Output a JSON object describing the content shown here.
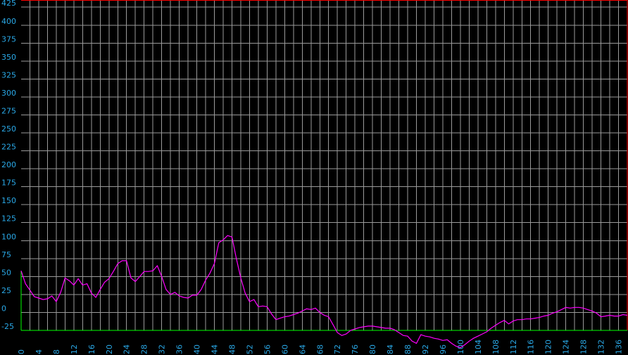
{
  "colors": {
    "background": "#000000",
    "grid": "#9a9a9a",
    "tick_label": "#2aa8e6",
    "series": "#ff00ff",
    "top_border": "#ff0000",
    "baseline": "#00ff00"
  },
  "chart_data": {
    "type": "line",
    "xlim": [
      0,
      138
    ],
    "ylim": [
      -25,
      435
    ],
    "grid": true,
    "legend": "none",
    "x_ticks": [
      0,
      4,
      8,
      12,
      16,
      20,
      24,
      28,
      32,
      36,
      40,
      44,
      48,
      52,
      56,
      60,
      64,
      68,
      72,
      76,
      80,
      84,
      88,
      92,
      96,
      100,
      104,
      108,
      112,
      116,
      120,
      124,
      128,
      132,
      136
    ],
    "x_tick_labels": [
      "0",
      "4",
      "8",
      "12",
      "16",
      "20",
      "24",
      "28",
      "32",
      "36",
      "40",
      "44",
      "48",
      "52",
      "56",
      "60",
      "64",
      "68",
      "72",
      "76",
      "80",
      "84",
      "88",
      "92",
      "96",
      "100",
      "104",
      "108",
      "112",
      "116",
      "120",
      "124",
      "128",
      "132",
      "136"
    ],
    "y_ticks": [
      -25,
      0,
      25,
      50,
      75,
      100,
      125,
      150,
      175,
      200,
      225,
      250,
      275,
      300,
      325,
      350,
      375,
      400,
      425
    ],
    "y_tick_labels": [
      "-25",
      "0",
      "25",
      "50",
      "75",
      "100",
      "125",
      "150",
      "175",
      "200",
      "225",
      "250",
      "275",
      "300",
      "325",
      "350",
      "375",
      "400",
      "425"
    ],
    "series": [
      {
        "x": [
          0,
          1,
          2,
          3,
          4,
          5,
          6,
          7,
          8,
          9,
          10,
          11,
          12,
          13,
          14,
          15,
          16,
          17,
          18,
          19,
          20,
          21,
          22,
          23,
          24,
          25,
          26,
          27,
          28,
          29,
          30,
          31,
          32,
          33,
          34,
          35,
          36,
          37,
          38,
          39,
          40,
          41,
          42,
          43,
          44,
          45,
          46,
          47,
          48,
          49,
          50,
          51,
          52,
          53,
          54,
          55,
          56,
          57,
          58,
          59,
          60,
          61,
          62,
          63,
          64,
          65,
          66,
          67,
          68,
          69,
          70,
          71,
          72,
          73,
          74,
          75,
          76,
          77,
          78,
          79,
          80,
          81,
          82,
          83,
          84,
          85,
          86,
          87,
          88,
          89,
          90,
          91,
          92,
          93,
          94,
          95,
          96,
          97,
          98,
          99,
          100,
          101,
          102,
          103,
          104,
          105,
          106,
          107,
          108,
          109,
          110,
          111,
          112,
          113,
          114,
          115,
          116,
          117,
          118,
          119,
          120,
          121,
          122,
          123,
          124,
          125,
          126,
          127,
          128,
          129,
          130,
          131,
          132,
          133,
          134,
          135,
          136,
          137,
          138
        ],
        "y": [
          58,
          40,
          31,
          22,
          20,
          18,
          19,
          23,
          15,
          28,
          48,
          44,
          38,
          47,
          38,
          40,
          27,
          21,
          32,
          42,
          47,
          57,
          68,
          72,
          72,
          48,
          43,
          50,
          57,
          57,
          58,
          65,
          50,
          32,
          25,
          28,
          23,
          21,
          20,
          24,
          24,
          32,
          45,
          55,
          68,
          97,
          101,
          107,
          105,
          75,
          48,
          27,
          15,
          18,
          8,
          9,
          8,
          -2,
          -10,
          -8,
          -6,
          -5,
          -3,
          -1,
          2,
          5,
          4,
          6,
          0,
          -4,
          -6,
          -17,
          -28,
          -32,
          -30,
          -25,
          -23,
          -21,
          -20,
          -19,
          -19,
          -20,
          -21,
          -22,
          -22,
          -24,
          -28,
          -32,
          -33,
          -40,
          -43,
          -31,
          -33,
          -34,
          -36,
          -37,
          -39,
          -38,
          -43,
          -47,
          -49,
          -45,
          -40,
          -36,
          -33,
          -30,
          -27,
          -22,
          -18,
          -14,
          -11,
          -16,
          -12,
          -10,
          -10,
          -9,
          -9,
          -8,
          -7,
          -5,
          -4,
          -1,
          1,
          4,
          7,
          6,
          7,
          7,
          6,
          4,
          2,
          -1,
          -6,
          -5,
          -4,
          -5,
          -5,
          -3,
          -4
        ]
      }
    ]
  }
}
